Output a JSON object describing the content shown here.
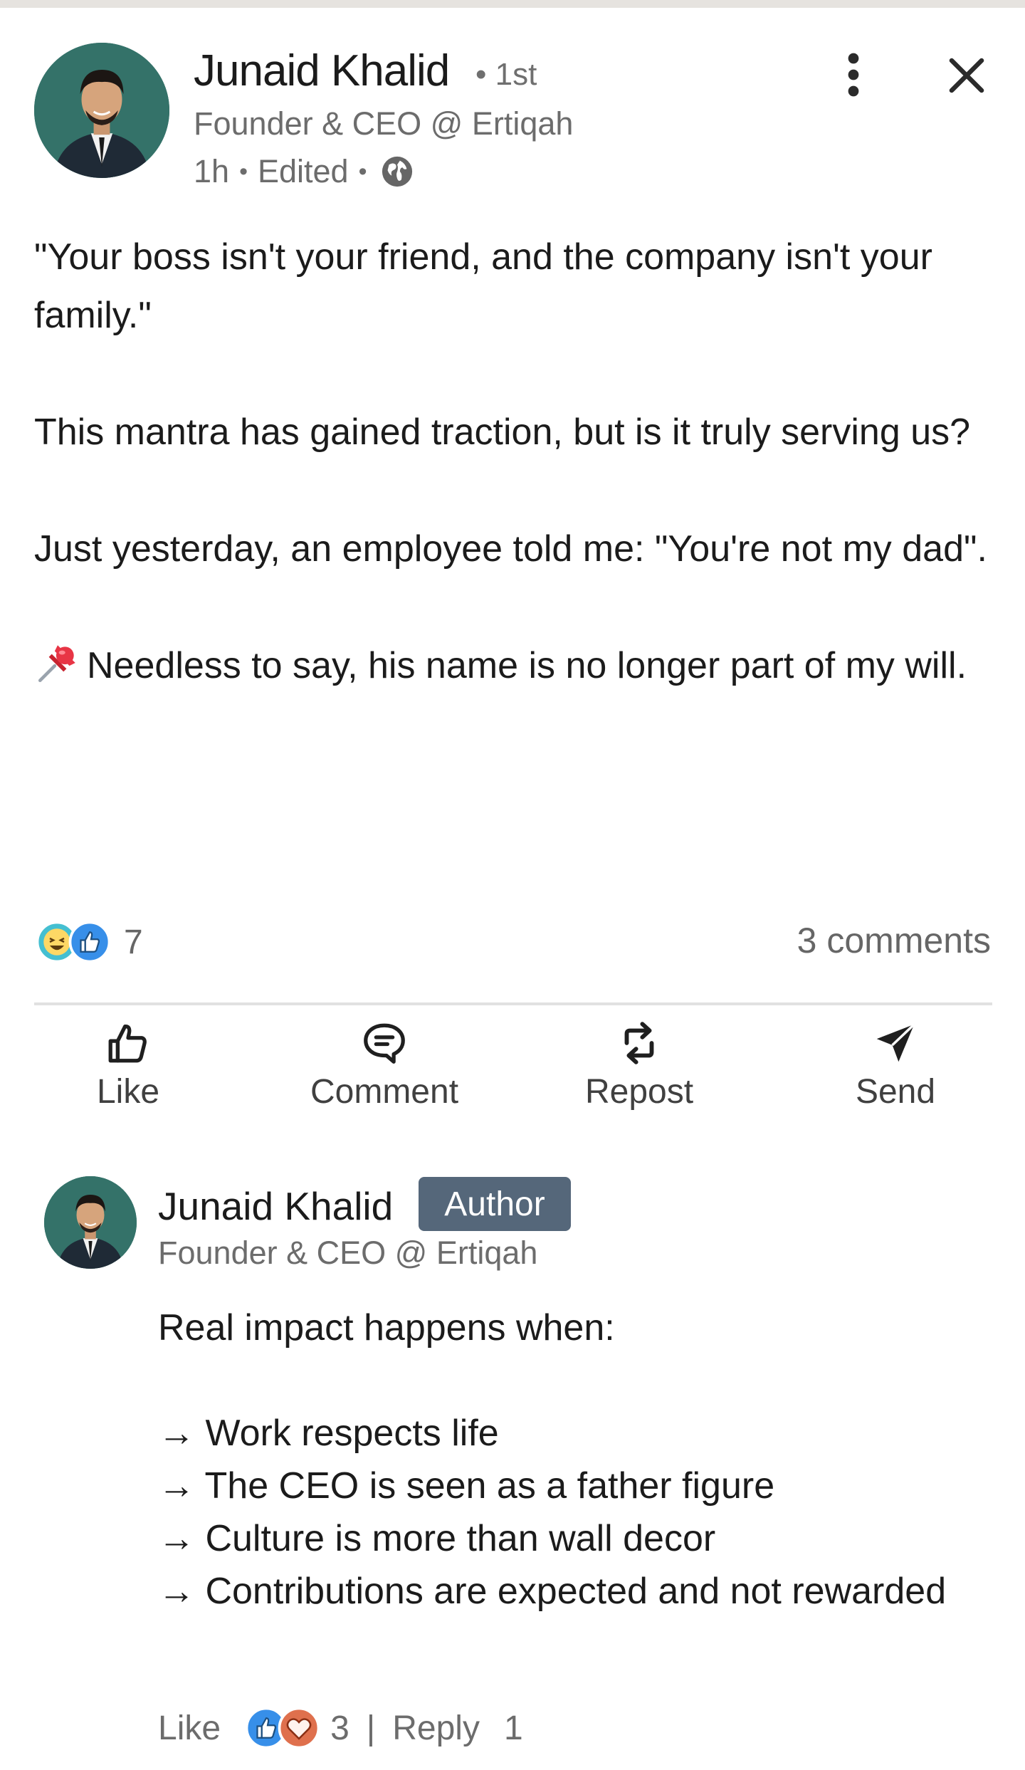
{
  "post": {
    "author": {
      "name": "Junaid Khalid",
      "degree": "• 1st",
      "headline": "Founder & CEO @ Ertiqah",
      "time": "1h",
      "edited": "Edited",
      "visibility_icon": "globe-icon"
    },
    "body": {
      "p1": "\"Your boss isn't your friend, and the company isn't your family.\"",
      "p2": "This mantra has gained traction, but is it truly serving us?",
      "p3": "Just yesterday, an employee told me: \"You're not my dad\".",
      "p4_emoji": "pushpin",
      "p4": "Needless to say, his name is no longer part of my will."
    },
    "reaction_icons": [
      "funny-icon",
      "like-icon"
    ],
    "reaction_count": "7",
    "comments_count": "3 comments"
  },
  "actions": {
    "like": "Like",
    "comment": "Comment",
    "repost": "Repost",
    "send": "Send"
  },
  "comment": {
    "name": "Junaid Khalid",
    "badge": "Author",
    "headline": "Founder & CEO @ Ertiqah",
    "intro": "Real impact happens when:",
    "items": [
      "→ Work respects life",
      "→ The CEO is seen as a father figure",
      "→ Culture is more than wall decor",
      "→ Contributions are expected and not rewarded"
    ],
    "like_label": "Like",
    "reaction_icons": [
      "like-icon",
      "love-icon"
    ],
    "reaction_count": "3",
    "separator": "|",
    "reply_label": "Reply",
    "reply_count": "1"
  },
  "colors": {
    "text": "#1b1b1b",
    "muted": "#6c6c6c",
    "badge_bg": "#55677a",
    "like_blue": "#378fe9",
    "love_orange": "#df704d",
    "funny_teal": "#44bfd1",
    "avatar_bg": "#2f6b63"
  }
}
